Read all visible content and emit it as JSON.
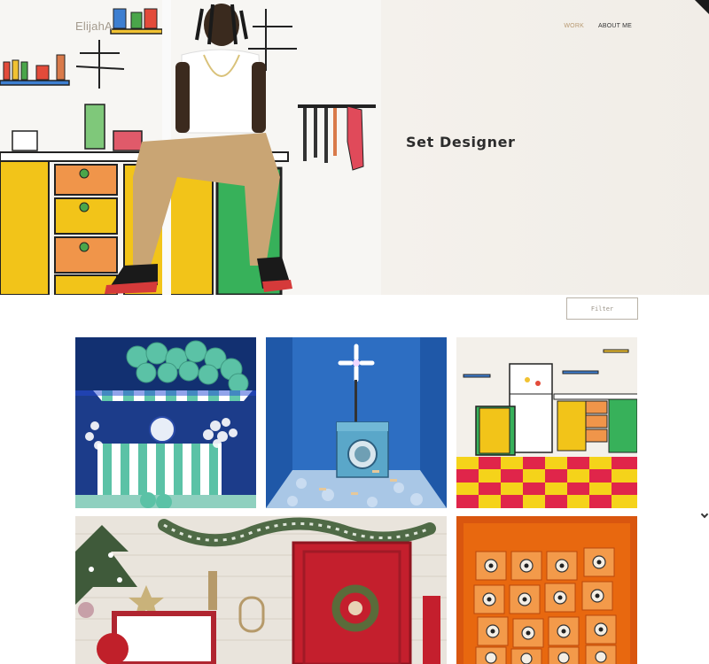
{
  "header": {
    "brand": "ElijahA",
    "nav": [
      {
        "label": "WORK",
        "active": true
      },
      {
        "label": "ABOUT ME",
        "active": false
      }
    ]
  },
  "hero": {
    "title": "Set Designer"
  },
  "filter": {
    "label": "Filter"
  },
  "gallery": {
    "items": [
      {
        "name": "balloon-market-stall-set"
      },
      {
        "name": "washing-machine-set"
      },
      {
        "name": "cartoon-kitchen-set"
      },
      {
        "name": "holiday-red-door-set"
      },
      {
        "name": "orange-speaker-wall-set"
      }
    ]
  },
  "colors": {
    "accent": "#b89a72",
    "text": "#2c2c2c"
  }
}
